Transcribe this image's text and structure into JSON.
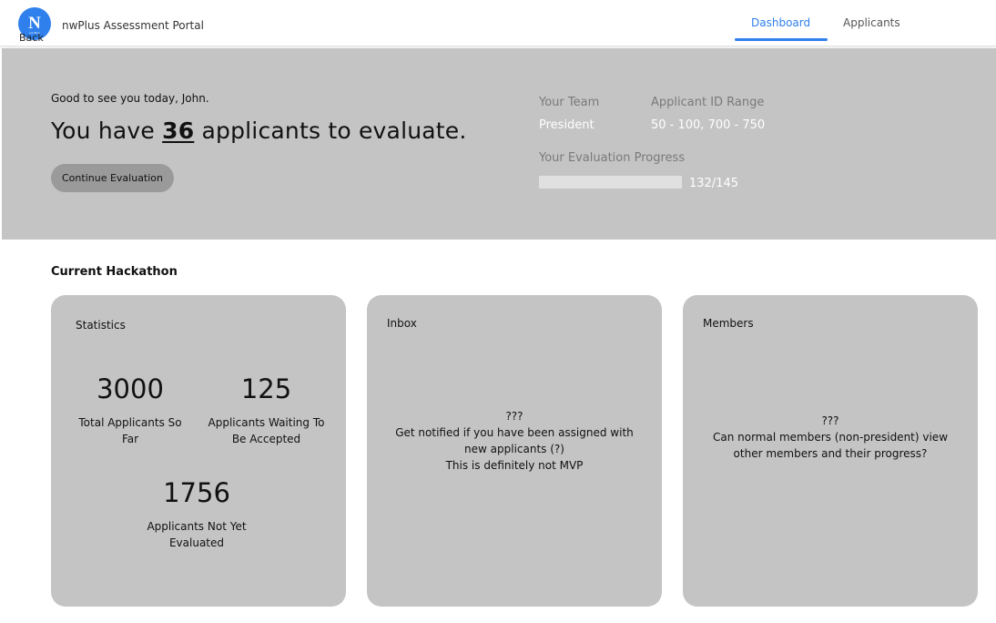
{
  "header": {
    "logo_text": "N",
    "logo_subtext": "nw Plus",
    "back_label": "Back",
    "app_title": "nwPlus Assessment Portal",
    "tabs": [
      {
        "label": "Dashboard",
        "active": true
      },
      {
        "label": "Applicants",
        "active": false
      }
    ],
    "accent_color": "#2f80ed"
  },
  "hero": {
    "greeting": "Good to see you today, John.",
    "headline_prefix": "You have",
    "applicant_count": "36",
    "headline_suffix": "applicants to evaluate.",
    "continue_label": "Continue Evaluation",
    "team_label": "Your Team",
    "team_value": "President",
    "range_label": "Applicant ID Range",
    "range_value": "50 - 100, 700 - 750",
    "progress_label": "Your Evaluation Progress",
    "progress_text": "132/145",
    "progress_fraction": 0.91
  },
  "section": {
    "title": "Current Hackathon"
  },
  "statistics": {
    "title": "Statistics",
    "total_value": "3000",
    "total_label": "Total Applicants So Far",
    "waiting_value": "125",
    "waiting_label": "Applicants Waiting To Be Accepted",
    "not_evaluated_value": "1756",
    "not_evaluated_label": "Applicants Not Yet Evaluated"
  },
  "inbox": {
    "title": "Inbox",
    "note": "???\nGet notified if you have been assigned with new applicants (?)\nThis is definitely not MVP"
  },
  "members": {
    "title": "Members",
    "note": "???\nCan normal members (non-president) view other members and their progress?"
  }
}
